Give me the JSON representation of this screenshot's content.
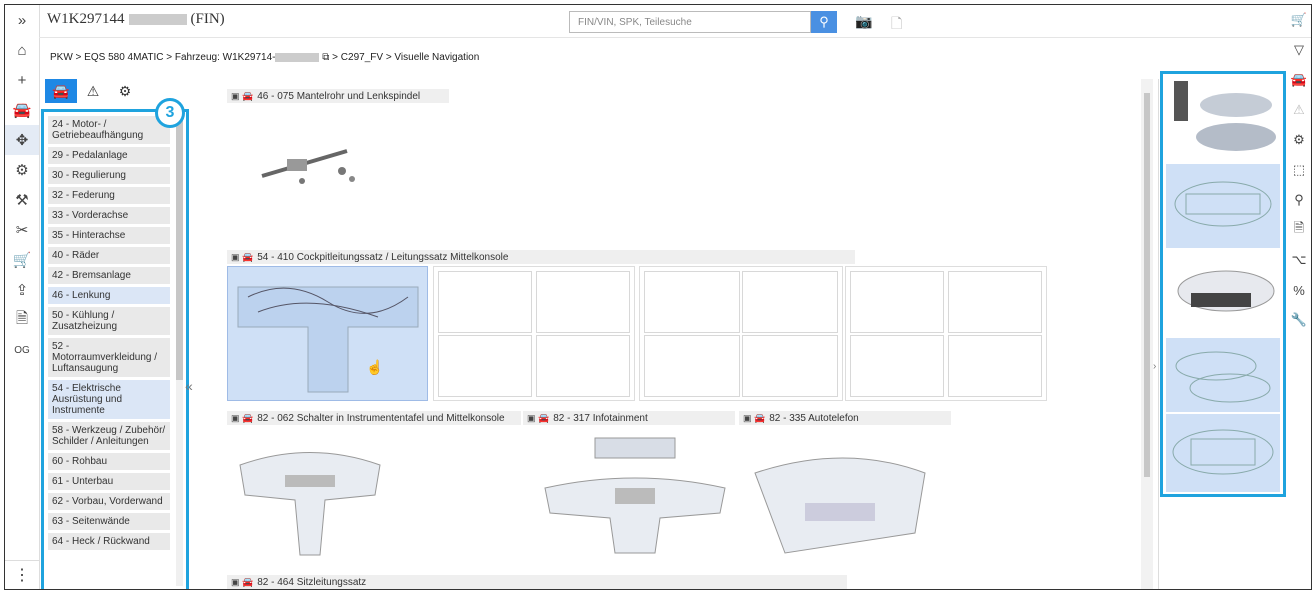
{
  "header": {
    "fin_prefix": "W1K297144",
    "fin_suffix": "(FIN)",
    "search_placeholder": "FIN/VIN, SPK, Teilesuche"
  },
  "breadcrumb": {
    "part1": "PKW > EQS 580 4MATIC > Fahrzeug: W1K29714-",
    "part2": "> C297_FV > Visuelle Navigation"
  },
  "badge_number": "3",
  "rail_left_og": "OG",
  "groups": [
    {
      "label": "24 - Motor- / Getriebeaufhängung",
      "highlight": false
    },
    {
      "label": "29 - Pedalanlage",
      "highlight": false
    },
    {
      "label": "30 - Regulierung",
      "highlight": false
    },
    {
      "label": "32 - Federung",
      "highlight": false
    },
    {
      "label": "33 - Vorderachse",
      "highlight": false
    },
    {
      "label": "35 - Hinterachse",
      "highlight": false
    },
    {
      "label": "40 - Räder",
      "highlight": false
    },
    {
      "label": "42 - Bremsanlage",
      "highlight": false
    },
    {
      "label": "46 - Lenkung",
      "highlight": true
    },
    {
      "label": "50 - Kühlung / Zusatzheizung",
      "highlight": false
    },
    {
      "label": "52 - Motorraumverkleidung / Luftansaugung",
      "highlight": false
    },
    {
      "label": "54 - Elektrische Ausrüstung und Instrumente",
      "highlight": true
    },
    {
      "label": "58 - Werkzeug / Zubehör/ Schilder / Anleitungen",
      "highlight": false
    },
    {
      "label": "60 - Rohbau",
      "highlight": false
    },
    {
      "label": "61 - Unterbau",
      "highlight": false
    },
    {
      "label": "62 - Vorbau, Vorderwand",
      "highlight": false
    },
    {
      "label": "63 - Seitenwände",
      "highlight": false
    },
    {
      "label": "64 - Heck / Rückwand",
      "highlight": false
    }
  ],
  "sections": {
    "s1": "46 - 075 Mantelrohr und Lenkspindel",
    "s2": "54 - 410 Cockpitleitungssatz / Leitungssatz Mittelkonsole",
    "s3": "82 - 062 Schalter in Instrumententafel und Mittelkonsole",
    "s4": "82 - 317 Infotainment",
    "s5": "82 - 335 Autotelefon",
    "s6": "82 - 464 Sitzleitungssatz"
  },
  "colors": {
    "accent": "#1fa3de",
    "selected": "#cfe0f6",
    "active_tab": "#1e88e5"
  }
}
